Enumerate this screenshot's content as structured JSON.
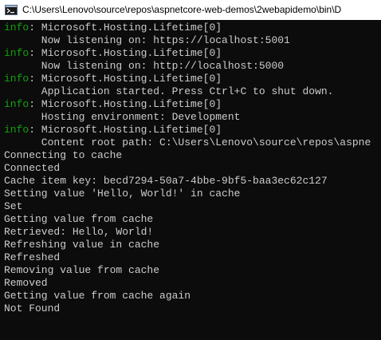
{
  "window": {
    "title": "C:\\Users\\Lenovo\\source\\repos\\aspnetcore-web-demos\\2webapidemo\\bin\\D",
    "icon": "console-icon"
  },
  "colors": {
    "background": "#0c0c0c",
    "text": "#cccccc",
    "info_level": "#13a10e"
  },
  "console": {
    "lines": [
      {
        "level": "info",
        "text": ": Microsoft.Hosting.Lifetime[0]"
      },
      {
        "level": "",
        "text": "      Now listening on: https://localhost:5001"
      },
      {
        "level": "info",
        "text": ": Microsoft.Hosting.Lifetime[0]"
      },
      {
        "level": "",
        "text": "      Now listening on: http://localhost:5000"
      },
      {
        "level": "info",
        "text": ": Microsoft.Hosting.Lifetime[0]"
      },
      {
        "level": "",
        "text": "      Application started. Press Ctrl+C to shut down."
      },
      {
        "level": "info",
        "text": ": Microsoft.Hosting.Lifetime[0]"
      },
      {
        "level": "",
        "text": "      Hosting environment: Development"
      },
      {
        "level": "info",
        "text": ": Microsoft.Hosting.Lifetime[0]"
      },
      {
        "level": "",
        "text": "      Content root path: C:\\Users\\Lenovo\\source\\repos\\aspne"
      },
      {
        "level": "",
        "text": "Connecting to cache"
      },
      {
        "level": "",
        "text": "Connected"
      },
      {
        "level": "",
        "text": "Cache item key: becd7294-50a7-4bbe-9bf5-baa3ec62c127"
      },
      {
        "level": "",
        "text": "Setting value 'Hello, World!' in cache"
      },
      {
        "level": "",
        "text": "Set"
      },
      {
        "level": "",
        "text": "Getting value from cache"
      },
      {
        "level": "",
        "text": "Retrieved: Hello, World!"
      },
      {
        "level": "",
        "text": "Refreshing value in cache"
      },
      {
        "level": "",
        "text": "Refreshed"
      },
      {
        "level": "",
        "text": "Removing value from cache"
      },
      {
        "level": "",
        "text": "Removed"
      },
      {
        "level": "",
        "text": "Getting value from cache again"
      },
      {
        "level": "",
        "text": "Not Found"
      }
    ]
  }
}
